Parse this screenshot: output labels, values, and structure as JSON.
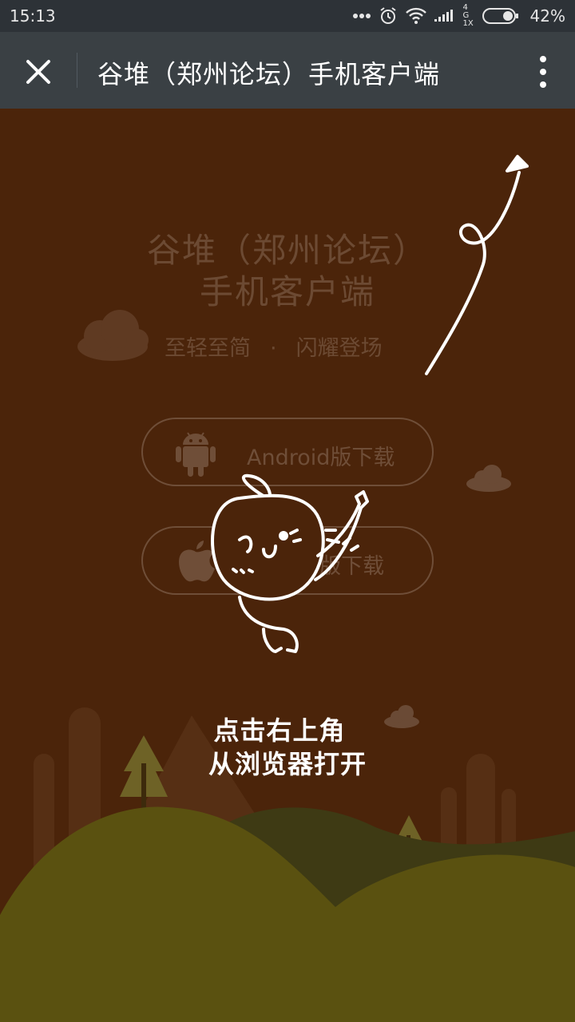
{
  "status_bar": {
    "time": "15:13",
    "network": "4G 1X",
    "battery": "42%"
  },
  "title_bar": {
    "title": "谷堆（郑州论坛）手机客户端",
    "close_icon": "close-icon",
    "more_icon": "more-vertical-icon"
  },
  "hero": {
    "line1": "谷堆（郑州论坛）",
    "line2": "手机客户端",
    "tag1": "至轻至简",
    "tag_sep": "·",
    "tag2": "闪耀登场"
  },
  "downloads": {
    "android_label": "Android版下载",
    "android_icon": "android-icon",
    "iphone_label": "iPhone版下载",
    "iphone_icon": "apple-icon"
  },
  "overlay": {
    "hint_line1": "点击右上角",
    "hint_line2": "从浏览器打开"
  },
  "colors": {
    "background": "#4b240a",
    "title_bar": "#3a4044",
    "status_bar": "#2d3237",
    "hill": "#5a5110",
    "muted_text": "#6c4a33"
  }
}
